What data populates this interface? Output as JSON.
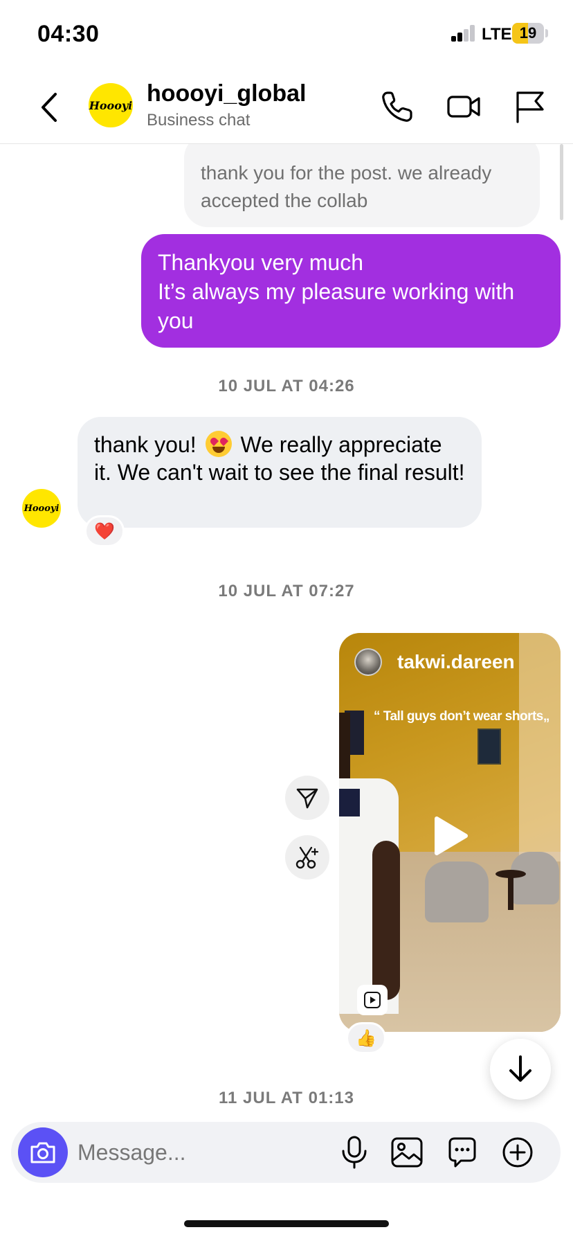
{
  "status_bar": {
    "time": "04:30",
    "network": "LTE",
    "battery_level": "19",
    "battery_fraction": 0.19
  },
  "header": {
    "contact_name": "hoooyi_global",
    "contact_subtitle": "Business chat",
    "avatar_text": "Hoooyi"
  },
  "messages": {
    "m1_text": "thank you for the post. we already accepted the collab",
    "m2_line1": "Thankyou very much",
    "m2_line2": "It’s always my pleasure working with you",
    "time1": "10 JUL AT 04:26",
    "m3_before_emoji": "thank you!",
    "m3_after_emoji": " We really appreciate it. We can't wait to see the final result!",
    "m3_reaction": "❤️",
    "time2": "10 JUL AT 07:27",
    "reel_user": "takwi.dareen",
    "reel_caption": "“ Tall guys don’t wear shorts„",
    "reel_reaction": "👍",
    "time3": "11 JUL AT 01:13"
  },
  "composer": {
    "placeholder": "Message..."
  },
  "colors": {
    "purple_bubble": "#a22fe0",
    "camera_button": "#5b51f5",
    "avatar_yellow": "#ffe600"
  },
  "icons": [
    "back-chevron-icon",
    "phone-icon",
    "video-camera-icon",
    "flag-icon",
    "play-icon",
    "reel-icon",
    "share-icon",
    "scissors-icon",
    "arrow-down-icon",
    "camera-icon",
    "microphone-icon",
    "gallery-icon",
    "sticker-icon",
    "plus-icon"
  ]
}
